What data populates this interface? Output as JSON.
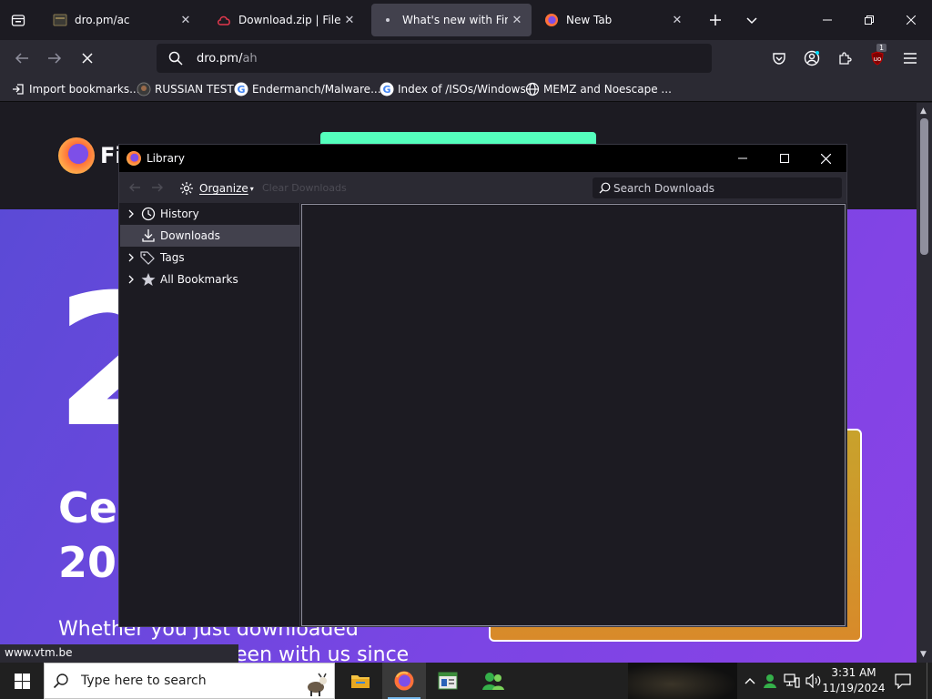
{
  "browser": {
    "tabs": [
      {
        "title": "dro.pm/ac",
        "active": false
      },
      {
        "title": "Download.zip | Files.fm",
        "active": false
      },
      {
        "title": "What's new with Firefox",
        "active": true
      },
      {
        "title": "New Tab",
        "active": false
      }
    ],
    "url": {
      "host": "dro.pm/",
      "path": "ah"
    },
    "extension_badge": "1",
    "bookmarks": [
      {
        "label": "Import bookmarks..."
      },
      {
        "label": "RUSSIAN TEST"
      },
      {
        "label": "Endermanch/Malware..."
      },
      {
        "label": "Index of /ISOs/Windows"
      },
      {
        "label": "MEMZ and Noescape ..."
      }
    ],
    "status_url": "www.vtm.be"
  },
  "page": {
    "brand_partial": "Fi",
    "big_digit": "2",
    "heading_line1": "Ce",
    "heading_line2": "20",
    "body_line1": "Whether you just downloaded",
    "body_line2": "een with us since"
  },
  "library": {
    "title": "Library",
    "organize_label": "Organize",
    "clear_downloads_label": "Clear Downloads",
    "search_placeholder": "Search Downloads",
    "tree": [
      {
        "label": "History",
        "expandable": true,
        "icon": "clock-icon"
      },
      {
        "label": "Downloads",
        "expandable": false,
        "icon": "download-icon",
        "selected": true
      },
      {
        "label": "Tags",
        "expandable": true,
        "icon": "tag-icon"
      },
      {
        "label": "All Bookmarks",
        "expandable": true,
        "icon": "star-icon"
      }
    ]
  },
  "taskbar": {
    "search_placeholder": "Type here to search",
    "time": "3:31 AM",
    "date": "11/19/2024"
  },
  "colors": {
    "accent_purple": "#7b45e4",
    "cta_green": "#54ffbd",
    "selected_row": "#42414d"
  }
}
